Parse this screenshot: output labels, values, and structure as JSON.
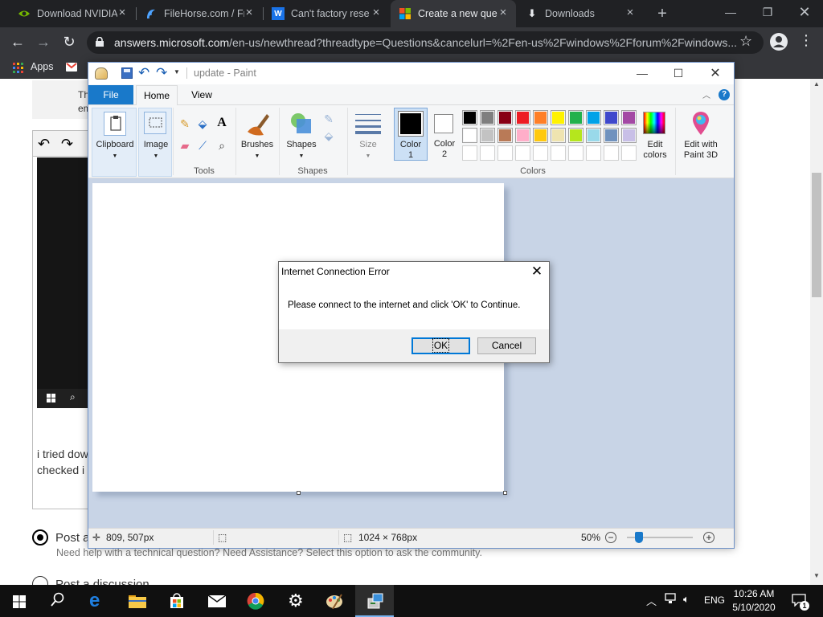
{
  "browser": {
    "tabs": [
      {
        "title": "Download NVIDIA",
        "favicon": "nvidia-icon",
        "active": false
      },
      {
        "title": "FileHorse.com / Fr",
        "favicon": "filehorse-icon",
        "active": false
      },
      {
        "title": "Can't factory rese",
        "favicon": "w-icon",
        "active": false
      },
      {
        "title": "Create a new que",
        "favicon": "microsoft-icon",
        "active": true
      },
      {
        "title": "Downloads",
        "favicon": "download-icon",
        "active": false
      }
    ],
    "url_host": "answers.microsoft.com",
    "url_path": "/en-us/newthread?threadtype=Questions&cancelurl=%2Fen-us%2Fwindows%2Fforum%2Fwindows...",
    "bookmarks": {
      "apps_label": "Apps"
    }
  },
  "page": {
    "notice_text": "Th\nem",
    "body_text": "i tried dow\nchecked i",
    "option1_label": "Post a",
    "option1_help": "Need help with a technical question? Need Assistance? Select this option to ask the community.",
    "option2_label": "Post a discussion"
  },
  "paint": {
    "title": "update - Paint",
    "tabs": {
      "file": "File",
      "home": "Home",
      "view": "View"
    },
    "ribbon": {
      "clipboard": "Clipboard",
      "image": "Image",
      "tools_group": "Tools",
      "brushes": "Brushes",
      "shapes": "Shapes",
      "shapes_group": "Shapes",
      "size": "Size",
      "color1_line1": "Color",
      "color1_line2": "1",
      "color2_line1": "Color",
      "color2_line2": "2",
      "colors_group": "Colors",
      "edit_colors_line1": "Edit",
      "edit_colors_line2": "colors",
      "paint3d_line1": "Edit with",
      "paint3d_line2": "Paint 3D"
    },
    "palette_row1": [
      "#000000",
      "#7f7f7f",
      "#880015",
      "#ed1c24",
      "#ff7f27",
      "#fff200",
      "#22b14c",
      "#00a2e8",
      "#3f48cc",
      "#a349a4"
    ],
    "palette_row2": [
      "#ffffff",
      "#c3c3c3",
      "#b97a57",
      "#ffaec9",
      "#ffc90e",
      "#efe4b0",
      "#b5e61d",
      "#99d9ea",
      "#7092be",
      "#c8bfe7"
    ],
    "color1": "#000000",
    "color2": "#ffffff",
    "status": {
      "cursor_pos": "809, 507px",
      "canvas_size": "1024 × 768px",
      "zoom": "50%",
      "zoom_fraction": 0.18
    }
  },
  "dialog": {
    "title": "Internet Connection Error",
    "message": "Please connect to the internet and click 'OK' to Continue.",
    "ok_label": "OK",
    "cancel_label": "Cancel"
  },
  "taskbar": {
    "time": "10:26 AM",
    "date": "5/10/2020",
    "lang": "ENG",
    "notifications": "1"
  }
}
